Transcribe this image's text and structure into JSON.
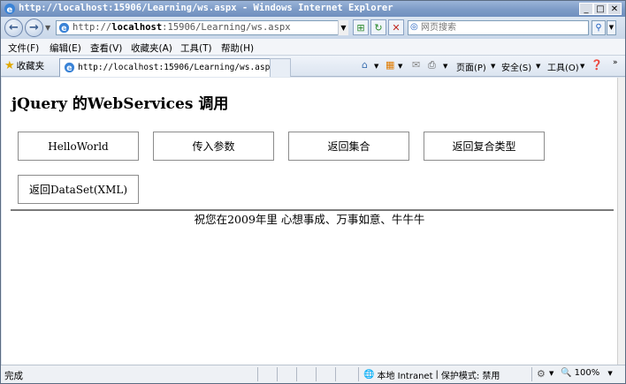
{
  "window": {
    "title": "http://localhost:15906/Learning/ws.aspx - Windows Internet Explorer"
  },
  "address": {
    "url_prefix": "http://",
    "url_host": "localhost",
    "url_rest": ":15906/Learning/ws.aspx"
  },
  "search": {
    "placeholder": "网页搜索"
  },
  "menu": {
    "items": [
      "文件(F)",
      "编辑(E)",
      "查看(V)",
      "收藏夹(A)",
      "工具(T)",
      "帮助(H)"
    ]
  },
  "favorites": {
    "label": "收藏夹"
  },
  "tab": {
    "label": "http://localhost:15906/Learning/ws.aspx"
  },
  "commandbar": {
    "page": "页面(P)",
    "safety": "安全(S)",
    "tools": "工具(O)"
  },
  "page": {
    "title": "jQuery 的WebServices 调用",
    "buttons": [
      "HelloWorld",
      "传入参数",
      "返回集合",
      "返回复合类型",
      "返回DataSet(XML)"
    ],
    "message": "祝您在2009年里 心想事成、万事如意、牛牛牛"
  },
  "status": {
    "text": "完成",
    "zone": "本地 Intranet",
    "protected_mode": "保护模式: 禁用",
    "zoom": "100%"
  }
}
